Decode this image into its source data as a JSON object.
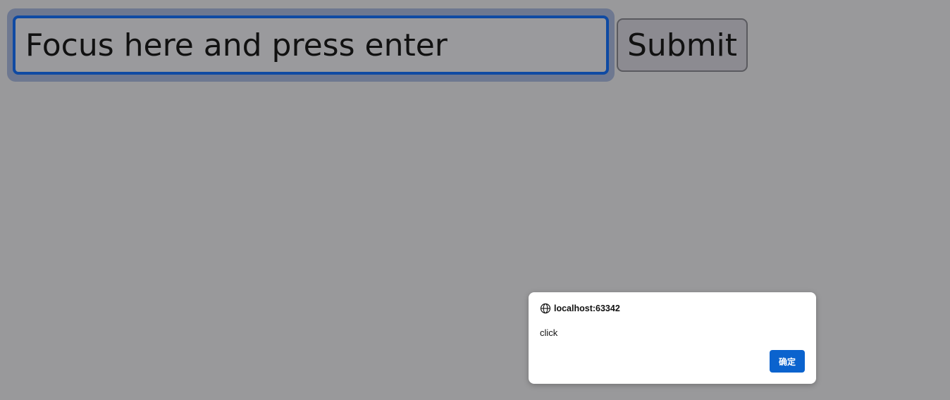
{
  "form": {
    "input_placeholder": "Focus here and press enter",
    "input_value": "",
    "submit_label": "Submit"
  },
  "alert_dialog": {
    "origin": "localhost:63342",
    "message": "click",
    "ok_label": "确定",
    "icon": "globe-icon"
  },
  "colors": {
    "page_background_dimmed": "#99999b",
    "focus_ring": "#0f4aa3",
    "dialog_button": "#0b63ce"
  }
}
